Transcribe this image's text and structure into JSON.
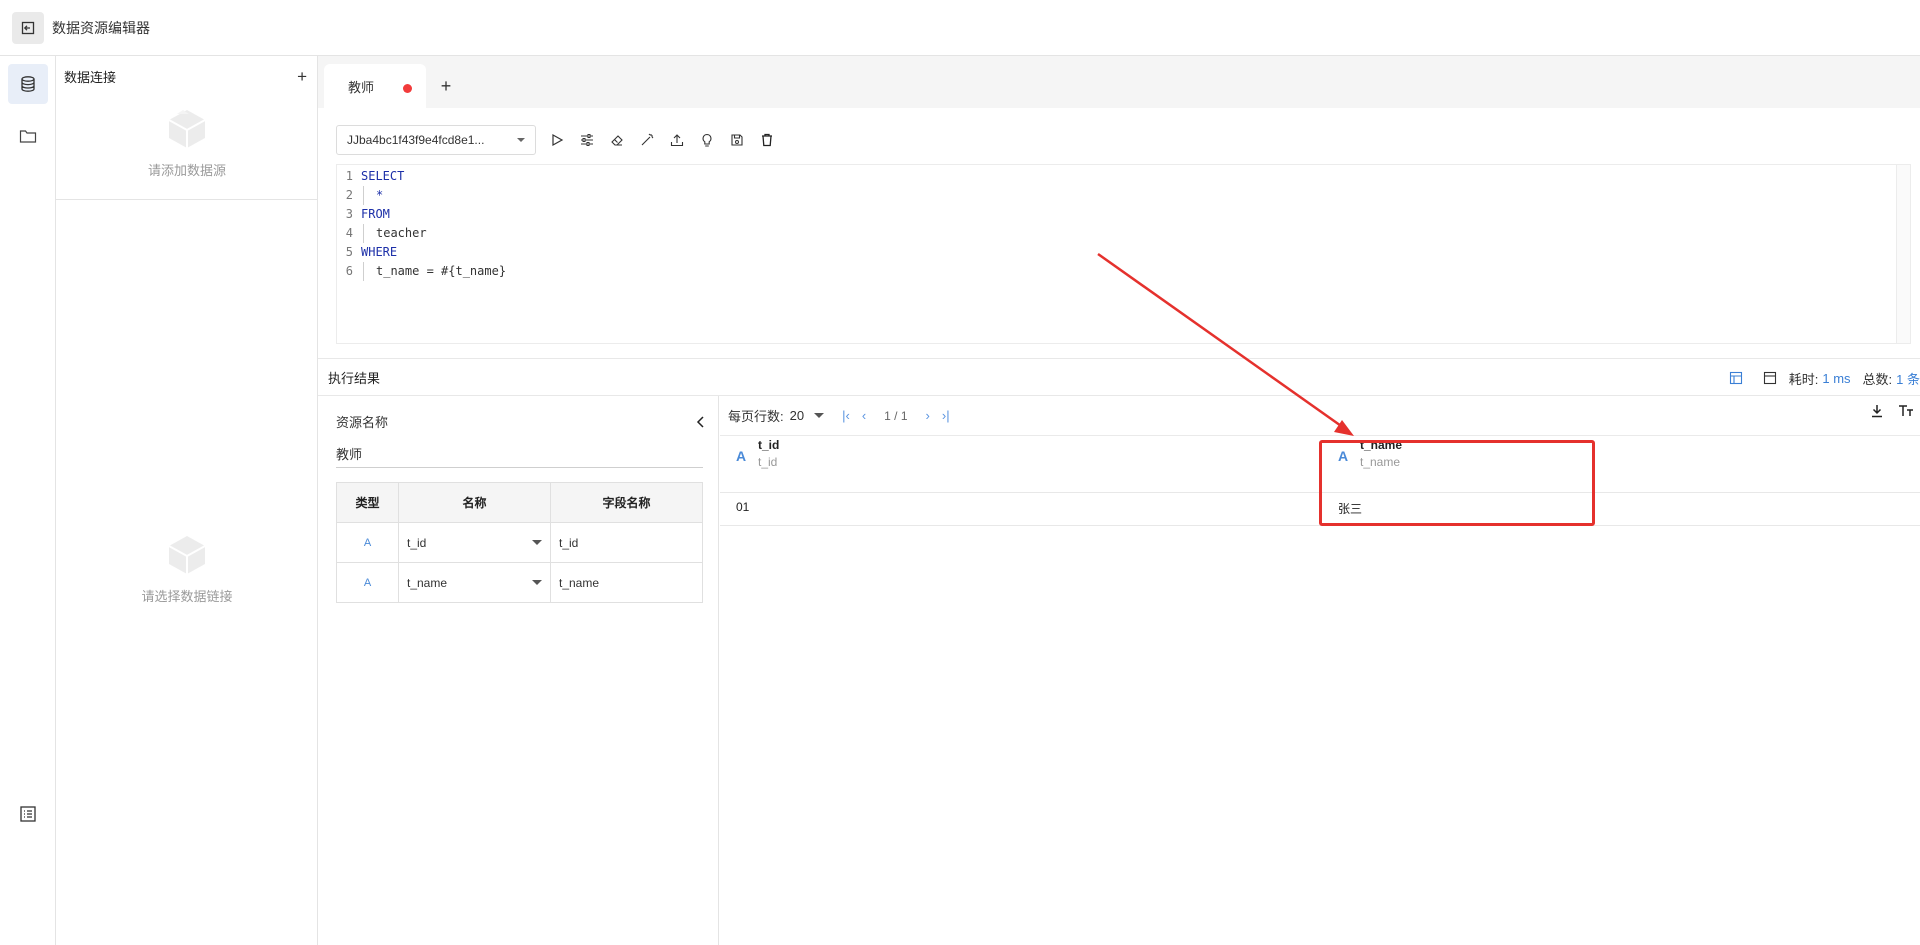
{
  "header": {
    "title": "数据资源编辑器"
  },
  "conn_panel": {
    "title": "数据连接",
    "empty_add": "请添加数据源",
    "empty_select": "请选择数据链接"
  },
  "tabs": [
    {
      "label": "教师"
    }
  ],
  "toolbar": {
    "datasource": "JJba4bc1f43f9e4fcd8e1..."
  },
  "editor": {
    "lines": [
      {
        "n": "1",
        "text": "SELECT"
      },
      {
        "n": "2",
        "text": "*"
      },
      {
        "n": "3",
        "text": "FROM"
      },
      {
        "n": "4",
        "text": "teacher"
      },
      {
        "n": "5",
        "text": "WHERE"
      },
      {
        "n": "6",
        "text": "t_name = #{t_name}"
      }
    ]
  },
  "results": {
    "title": "执行结果",
    "time_label": "耗时:",
    "time_value": "1 ms",
    "total_label": "总数:",
    "total_value": "1 条"
  },
  "resource": {
    "label": "资源名称",
    "name": "教师",
    "columns": [
      "类型",
      "名称",
      "字段名称"
    ],
    "rows": [
      {
        "type": "A",
        "name": "t_id",
        "field": "t_id"
      },
      {
        "type": "A",
        "name": "t_name",
        "field": "t_name"
      }
    ]
  },
  "grid": {
    "page_size_label": "每页行数:",
    "page_size": "20",
    "page_info": "1 / 1",
    "columns": [
      {
        "name": "t_id",
        "field": "t_id"
      },
      {
        "name": "t_name",
        "field": "t_name"
      }
    ],
    "rows": [
      [
        "01",
        "张三"
      ]
    ]
  },
  "colors": {
    "accent": "#3a7fd5",
    "highlight": "#e5312d",
    "unsaved_dot": "#f23b3b"
  }
}
